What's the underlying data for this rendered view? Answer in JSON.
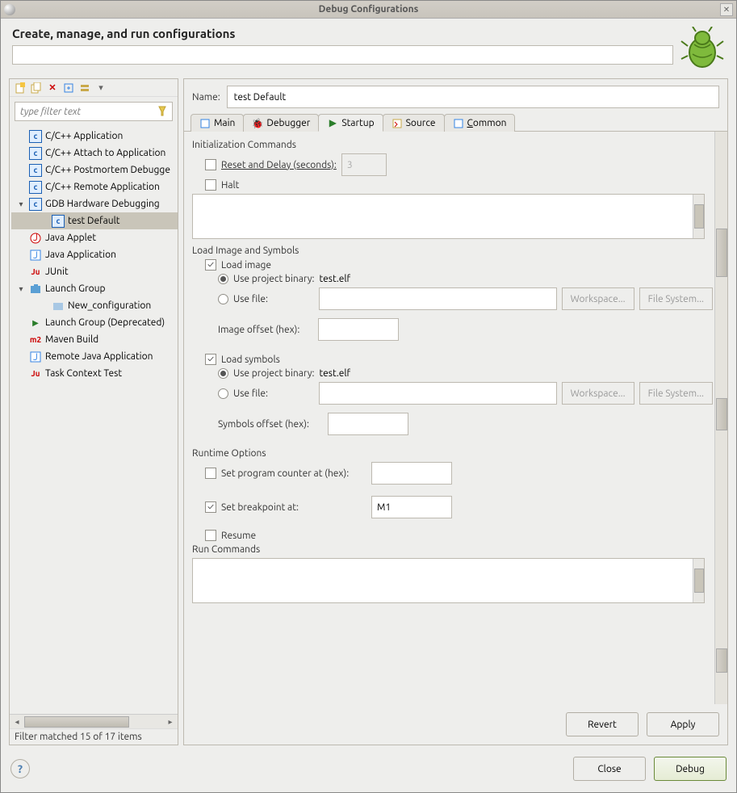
{
  "window": {
    "title": "Debug Configurations"
  },
  "header": {
    "heading": "Create, manage, and run configurations"
  },
  "filter": {
    "placeholder": "type filter text"
  },
  "tree": {
    "items": [
      {
        "label": "C/C++ Application",
        "type": "c"
      },
      {
        "label": "C/C++ Attach to Application",
        "type": "c"
      },
      {
        "label": "C/C++ Postmortem Debugger",
        "type": "c",
        "truncated": "C/C++ Postmortem Debugge"
      },
      {
        "label": "C/C++ Remote Application",
        "type": "c"
      },
      {
        "label": "GDB Hardware Debugging",
        "type": "c",
        "expanded": true,
        "children": [
          {
            "label": "test Default",
            "type": "c",
            "selected": true
          }
        ]
      },
      {
        "label": "Java Applet",
        "type": "j"
      },
      {
        "label": "Java Application",
        "type": "j"
      },
      {
        "label": "JUnit",
        "type": "ju"
      },
      {
        "label": "Launch Group",
        "type": "grp",
        "expanded": true,
        "children": [
          {
            "label": "New_configuration",
            "type": "grp2"
          }
        ]
      },
      {
        "label": "Launch Group (Deprecated)",
        "type": "grp2"
      },
      {
        "label": "Maven Build",
        "type": "m2"
      },
      {
        "label": "Remote Java Application",
        "type": "j"
      },
      {
        "label": "Task Context Test",
        "type": "ju"
      }
    ],
    "status": "Filter matched 15 of 17 items"
  },
  "config": {
    "name_label": "Name:",
    "name_value": "test Default",
    "tabs": {
      "main": "Main",
      "debugger": "Debugger",
      "startup": "Startup",
      "source": "Source",
      "common": "Common",
      "active": "startup"
    },
    "startup": {
      "init_section": "Initialization Commands",
      "reset_delay_label": "Reset and Delay (seconds):",
      "reset_delay_checked": false,
      "reset_delay_value": "3",
      "halt_label": "Halt",
      "halt_checked": false,
      "init_commands": "",
      "load_section": "Load Image and Symbols",
      "load_image_label": "Load image",
      "load_image_checked": true,
      "image_use_project_label": "Use project binary:",
      "image_project_binary": "test.elf",
      "image_use_project_selected": true,
      "image_use_file_label": "Use file:",
      "image_file_value": "",
      "image_use_file_selected": false,
      "workspace_btn": "Workspace...",
      "filesystem_btn": "File System...",
      "image_offset_label": "Image offset (hex):",
      "image_offset_value": "",
      "load_symbols_label": "Load symbols",
      "load_symbols_checked": true,
      "sym_use_project_label": "Use project binary:",
      "sym_project_binary": "test.elf",
      "sym_use_project_selected": true,
      "sym_use_file_label": "Use file:",
      "sym_file_value": "",
      "sym_use_file_selected": false,
      "sym_offset_label": "Symbols offset (hex):",
      "sym_offset_value": "",
      "runtime_section": "Runtime Options",
      "pc_label": "Set program counter at (hex):",
      "pc_checked": false,
      "pc_value": "",
      "bp_label": "Set breakpoint at:",
      "bp_checked": true,
      "bp_value": "M1",
      "resume_label": "Resume",
      "resume_checked": false,
      "run_section": "Run Commands",
      "run_commands": ""
    },
    "buttons": {
      "revert": "Revert",
      "apply": "Apply"
    }
  },
  "footer": {
    "close": "Close",
    "debug": "Debug"
  }
}
